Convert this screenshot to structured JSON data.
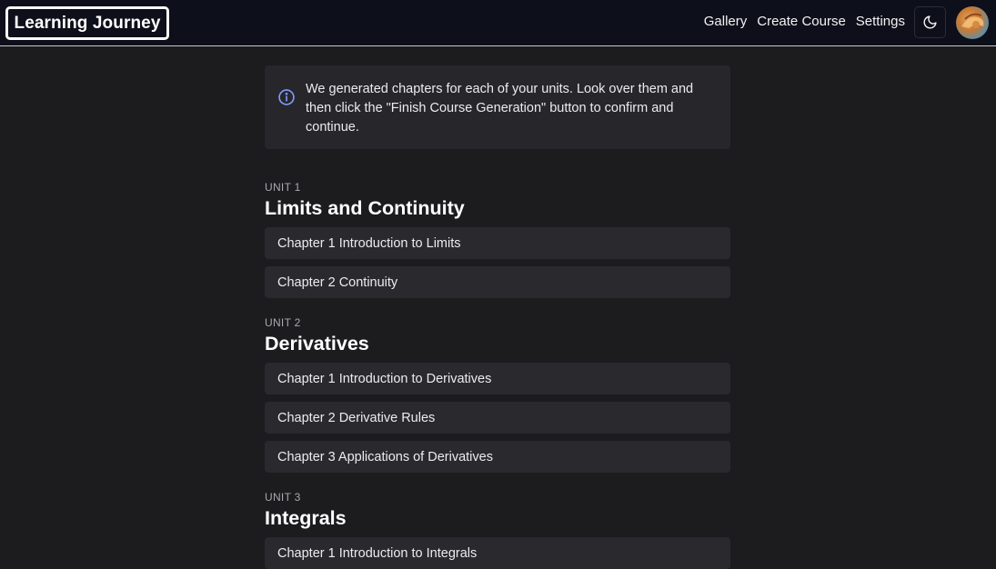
{
  "app": {
    "logo": "Learning Journey"
  },
  "nav": {
    "items": [
      {
        "label": "Gallery"
      },
      {
        "label": "Create Course"
      },
      {
        "label": "Settings"
      }
    ]
  },
  "alert": {
    "text": "We generated chapters for each of your units. Look over them and then click the \"Finish Course Generation\" button to confirm and continue."
  },
  "units": [
    {
      "label": "UNIT 1",
      "title": "Limits and Continuity",
      "chapters": [
        {
          "label": "Chapter 1 Introduction to Limits"
        },
        {
          "label": "Chapter 2 Continuity"
        }
      ]
    },
    {
      "label": "UNIT 2",
      "title": "Derivatives",
      "chapters": [
        {
          "label": "Chapter 1 Introduction to Derivatives"
        },
        {
          "label": "Chapter 2 Derivative Rules"
        },
        {
          "label": "Chapter 3 Applications of Derivatives"
        }
      ]
    },
    {
      "label": "UNIT 3",
      "title": "Integrals",
      "chapters": [
        {
          "label": "Chapter 1 Introduction to Integrals"
        }
      ]
    }
  ],
  "icons": {
    "theme_toggle": "moon-icon",
    "alert": "info-icon"
  },
  "colors": {
    "background": "#1c1b1e",
    "navbar": "#0d0f1a",
    "card": "#2a292e",
    "info_icon": "#7f9cf5"
  }
}
